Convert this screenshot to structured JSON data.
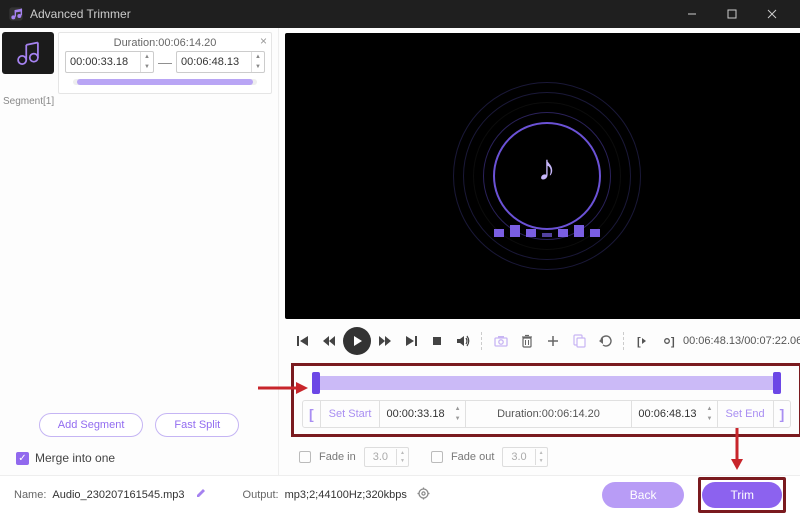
{
  "app": {
    "title": "Advanced Trimmer"
  },
  "segment": {
    "label": "Segment[1]",
    "duration_label": "Duration:00:06:14.20",
    "start": "00:00:33.18",
    "end": "00:06:48.13"
  },
  "buttons": {
    "add_segment": "Add Segment",
    "fast_split": "Fast Split",
    "merge": "Merge into one",
    "back": "Back",
    "trim": "Trim",
    "set_start": "Set Start",
    "set_end": "Set End"
  },
  "playback": {
    "current": "00:06:48.13",
    "total": "00:07:22.06"
  },
  "trim": {
    "start": "00:00:33.18",
    "end": "00:06:48.13",
    "duration_label": "Duration:00:06:14.20"
  },
  "fade": {
    "in_label": "Fade in",
    "in_value": "3.0",
    "out_label": "Fade out",
    "out_value": "3.0"
  },
  "footer": {
    "name_label": "Name:",
    "name_value": "Audio_230207161545.mp3",
    "output_label": "Output:",
    "output_value": "mp3;2;44100Hz;320kbps"
  },
  "colors": {
    "accent": "#8c62ef",
    "annotation": "#b42026"
  }
}
